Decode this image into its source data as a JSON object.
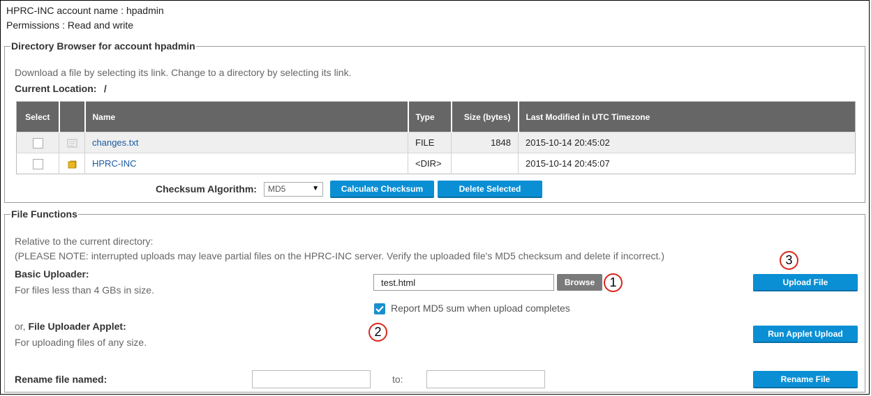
{
  "account": {
    "name_line": "HPRC-INC account name : hpadmin",
    "permissions_line": "Permissions : Read and write"
  },
  "directory_browser": {
    "legend": "Directory Browser for account hpadmin",
    "instructions": "Download a file by selecting its link. Change to a directory by selecting its link.",
    "current_location_label": "Current Location:",
    "current_location_value": "/",
    "columns": [
      "Select",
      "",
      "Name",
      "Type",
      "Size (bytes)",
      "Last Modified in UTC Timezone"
    ],
    "rows": [
      {
        "icon": "file-icon",
        "name": "changes.txt",
        "type": "FILE",
        "size": "1848",
        "modified": "2015-10-14 20:45:02"
      },
      {
        "icon": "folder-icon",
        "name": "HPRC-INC",
        "type": "<DIR>",
        "size": "",
        "modified": "2015-10-14 20:45:07"
      }
    ],
    "checksum_label": "Checksum Algorithm:",
    "checksum_value": "MD5",
    "calculate_button": "Calculate Checksum",
    "delete_button": "Delete Selected"
  },
  "file_functions": {
    "legend": "File Functions",
    "relative_note": "Relative to the current directory:",
    "warning_note": "(PLEASE NOTE: interrupted uploads may leave partial files on the HPRC-INC server. Verify the uploaded file's MD5 checksum and delete if incorrect.)",
    "basic_uploader_title": "Basic Uploader:",
    "basic_uploader_desc": "For files less than 4 GBs in size.",
    "file_input_value": "test.html",
    "browse_button": "Browse",
    "report_md5_label": "Report MD5 sum when upload completes",
    "report_md5_checked": true,
    "upload_button": "Upload File",
    "applet_prefix": "or, ",
    "applet_title": "File Uploader Applet:",
    "applet_desc": "For uploading files of any size.",
    "applet_button": "Run Applet Upload",
    "rename_label": "Rename file named:",
    "rename_to_label": "to:",
    "rename_from_value": "",
    "rename_to_value": "",
    "rename_button": "Rename File"
  },
  "markers": [
    "1",
    "2",
    "3"
  ],
  "colors": {
    "accent_button": "#0b8fd4",
    "table_header": "#666666",
    "marker_ring": "#d9261c",
    "link": "#1a5aa0"
  }
}
